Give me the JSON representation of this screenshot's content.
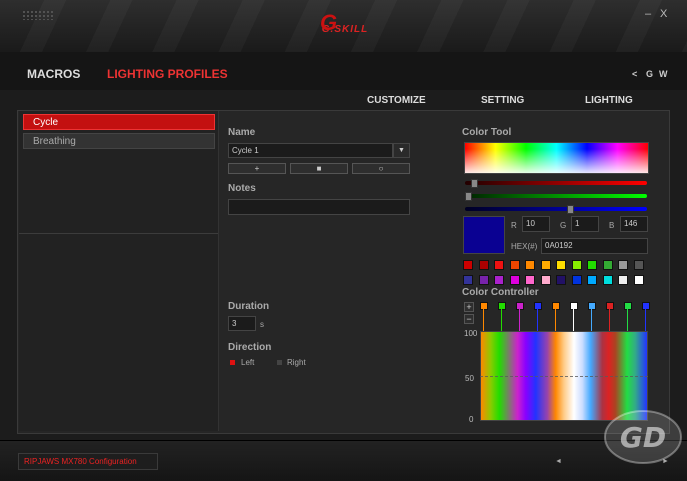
{
  "window": {
    "minimize_label": "–",
    "close_label": "X"
  },
  "logo": {
    "text": "G.SKILL",
    "mark": "G"
  },
  "nav": {
    "macros": "MACROS",
    "lighting_profiles": "LIGHTING PROFILES"
  },
  "social": {
    "share": "<",
    "g": "G",
    "w": "W"
  },
  "subnav": {
    "customize": "CUSTOMIZE",
    "setting": "SETTING",
    "lighting": "LIGHTING"
  },
  "profiles": {
    "items": [
      {
        "label": "Cycle",
        "selected": true
      },
      {
        "label": "Breathing",
        "selected": false
      }
    ]
  },
  "name": {
    "label": "Name",
    "value": "Cycle 1",
    "add": "+",
    "delete": "■",
    "refresh": "○"
  },
  "notes": {
    "label": "Notes",
    "value": ""
  },
  "duration": {
    "label": "Duration",
    "value": "3",
    "unit": "s"
  },
  "direction": {
    "label": "Direction",
    "left": "Left",
    "right": "Right",
    "selected": "Left"
  },
  "color_tool": {
    "label": "Color Tool",
    "r_label": "R",
    "r": "10",
    "g_label": "G",
    "g": "1",
    "b_label": "B",
    "b": "146",
    "hex_label": "HEX(#)",
    "hex": "0A0192",
    "current_color": "#0A0192",
    "swatches_row1": [
      "#cc0000",
      "#aa0000",
      "#ee1111",
      "#ee4400",
      "#ff8800",
      "#ffaa00",
      "#ffdd00",
      "#88ee00",
      "#22dd00",
      "#33aa33",
      "#999999",
      "#555555"
    ],
    "swatches_row2": [
      "#333399",
      "#7722aa",
      "#aa22cc",
      "#dd00dd",
      "#ff66cc",
      "#ffaacc",
      "#221166",
      "#0033dd",
      "#00aaff",
      "#00dddd",
      "#eeeeee",
      "#ffffff"
    ]
  },
  "color_controller": {
    "label": "Color Controller",
    "add": "+",
    "remove": "−",
    "y_ticks": [
      "100",
      "50",
      "0"
    ],
    "markers": [
      "#ff8800",
      "#22dd00",
      "#cc22cc",
      "#2233ff",
      "#ff8800",
      "#ffffff",
      "#44aaff",
      "#dd2222",
      "#22dd44",
      "#2233ff"
    ]
  },
  "footer": {
    "config_label": "RIPJAWS MX780 Configuration",
    "prev": "◄",
    "next": "►"
  },
  "watermark": {
    "text": "GD"
  }
}
